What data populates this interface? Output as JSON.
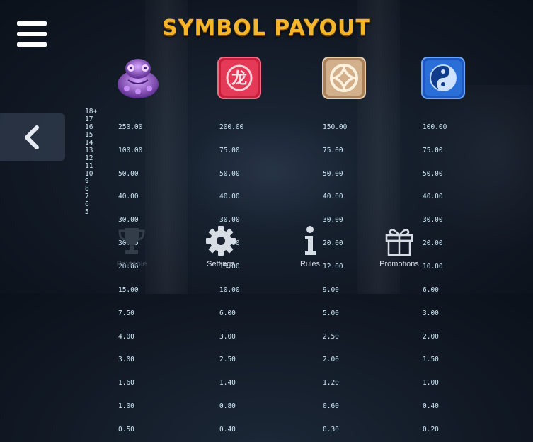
{
  "title": "SYMBOL PAYOUT",
  "menu": {
    "icon": "hamburger-icon"
  },
  "nav_prev": {
    "icon": "chevron-left-icon"
  },
  "counts": [
    "18+",
    "17",
    "16",
    "15",
    "14",
    "13",
    "12",
    "11",
    "10",
    "9",
    "8",
    "7",
    "6",
    "5"
  ],
  "symbols": [
    {
      "name": "purple-toad",
      "icon": "purple-toad-icon",
      "color": "#9b5fd6",
      "payouts": [
        "250.00",
        "100.00",
        "50.00",
        "40.00",
        "30.00",
        "30.00",
        "20.00",
        "15.00",
        "7.50",
        "4.00",
        "3.00",
        "1.60",
        "1.00",
        "0.50"
      ]
    },
    {
      "name": "red-dragon-character",
      "icon": "dragon-character-icon",
      "color": "#d8324c",
      "payouts": [
        "200.00",
        "75.00",
        "50.00",
        "40.00",
        "30.00",
        "20.00",
        "15.00",
        "10.00",
        "6.00",
        "3.00",
        "2.50",
        "1.40",
        "0.80",
        "0.40"
      ]
    },
    {
      "name": "bronze-coin",
      "icon": "coin-icon",
      "color": "#c9a47e",
      "payouts": [
        "150.00",
        "75.00",
        "50.00",
        "40.00",
        "30.00",
        "20.00",
        "12.00",
        "9.00",
        "5.00",
        "2.50",
        "2.00",
        "1.20",
        "0.60",
        "0.30"
      ]
    },
    {
      "name": "blue-yin-yang",
      "icon": "yin-yang-icon",
      "color": "#2a6fd8",
      "payouts": [
        "100.00",
        "75.00",
        "50.00",
        "40.00",
        "30.00",
        "20.00",
        "10.00",
        "6.00",
        "3.00",
        "2.00",
        "1.50",
        "1.00",
        "0.40",
        "0.20"
      ]
    }
  ],
  "bottom_nav": [
    {
      "label": "Paytable",
      "icon": "trophy-icon",
      "active": false
    },
    {
      "label": "Settings",
      "icon": "gear-icon",
      "active": true
    },
    {
      "label": "Rules",
      "icon": "info-icon",
      "active": true
    },
    {
      "label": "Promotions",
      "icon": "gift-icon",
      "active": true
    }
  ]
}
